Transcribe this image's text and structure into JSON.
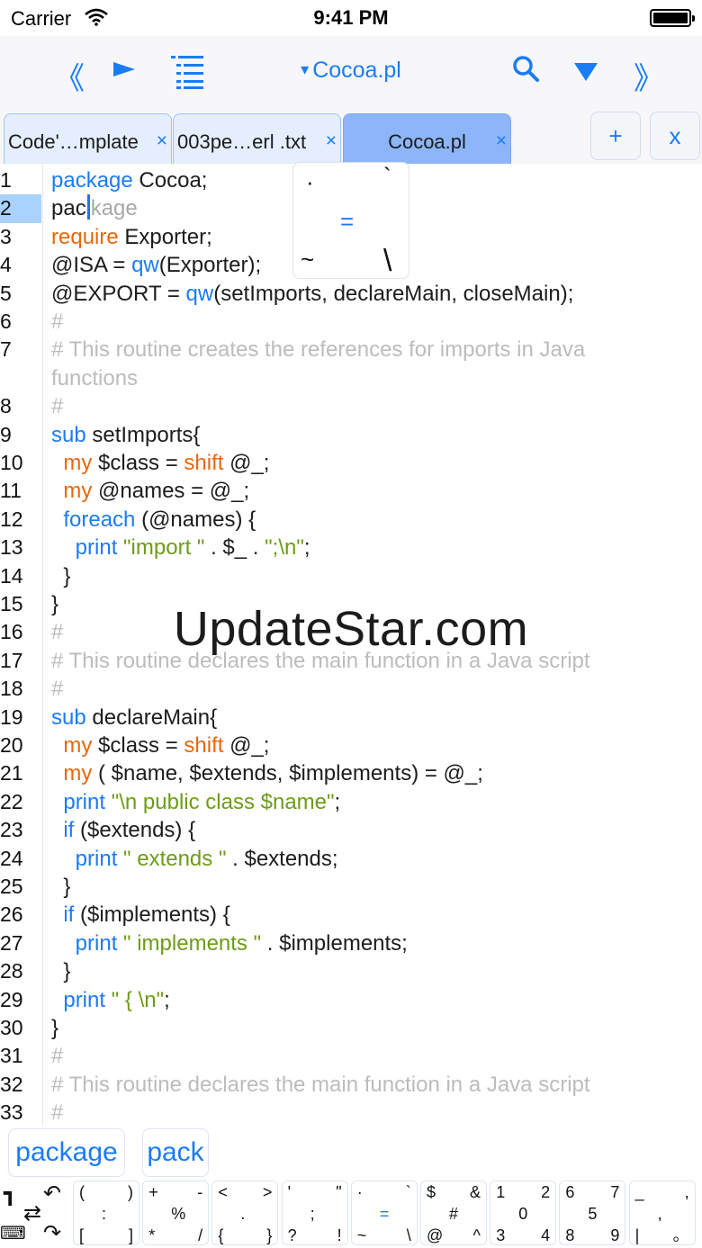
{
  "status": {
    "carrier": "Carrier",
    "time": "9:41 PM"
  },
  "toolbar": {
    "prev_label": "《",
    "next_label": "》",
    "file_caret": "▾",
    "file_name": "Cocoa.pl",
    "icons": [
      "double-chevron-left-icon",
      "play-icon",
      "outline-list-icon",
      "search-icon",
      "triangle-down-icon",
      "double-chevron-right-icon"
    ]
  },
  "tabs": [
    {
      "label": "Code'…mplate",
      "close": "×"
    },
    {
      "label": "003pe…erl .txt",
      "close": "×"
    },
    {
      "label": "Cocoa.pl",
      "close": "×"
    }
  ],
  "tab_actions": {
    "add": "+",
    "close": "x"
  },
  "editor": {
    "line_numbers": [
      "1",
      "2",
      "3",
      "4",
      "5",
      "6",
      "7",
      "",
      "8",
      "9",
      "10",
      "11",
      "12",
      "13",
      "14",
      "15",
      "16",
      "17",
      "18",
      "19",
      "20",
      "21",
      "22",
      "23",
      "24",
      "25",
      "26",
      "27",
      "28",
      "29",
      "30",
      "31",
      "32",
      "33"
    ],
    "lines": [
      [
        {
          "t": "package",
          "c": "k"
        },
        {
          "t": " Cocoa;",
          "c": ""
        }
      ],
      [
        {
          "t": "pac",
          "c": ""
        },
        {
          "t": "kage",
          "c": "ghost"
        }
      ],
      [
        {
          "t": "require",
          "c": "o"
        },
        {
          "t": " Exporter;",
          "c": ""
        }
      ],
      [
        {
          "t": "@ISA = ",
          "c": ""
        },
        {
          "t": "qw",
          "c": "k"
        },
        {
          "t": "(Exporter);",
          "c": ""
        }
      ],
      [
        {
          "t": "@EXPORT = ",
          "c": ""
        },
        {
          "t": "qw",
          "c": "k"
        },
        {
          "t": "(setImports, declareMain, closeMain);",
          "c": ""
        }
      ],
      [
        {
          "t": "#",
          "c": "c"
        }
      ],
      [
        {
          "t": "# This routine creates the references for imports in Java",
          "c": "c"
        }
      ],
      [
        {
          "t": "functions",
          "c": "c"
        }
      ],
      [
        {
          "t": "#",
          "c": "c"
        }
      ],
      [
        {
          "t": "sub",
          "c": "k"
        },
        {
          "t": " setImports{",
          "c": ""
        }
      ],
      [
        {
          "t": "  ",
          "c": ""
        },
        {
          "t": "my",
          "c": "o"
        },
        {
          "t": " $class = ",
          "c": ""
        },
        {
          "t": "shift",
          "c": "o"
        },
        {
          "t": " @_;",
          "c": ""
        }
      ],
      [
        {
          "t": "  ",
          "c": ""
        },
        {
          "t": "my",
          "c": "o"
        },
        {
          "t": " @names = @_;",
          "c": ""
        }
      ],
      [
        {
          "t": "  ",
          "c": ""
        },
        {
          "t": "foreach",
          "c": "k"
        },
        {
          "t": " (@names) {",
          "c": ""
        }
      ],
      [
        {
          "t": "    ",
          "c": ""
        },
        {
          "t": "print",
          "c": "k"
        },
        {
          "t": " ",
          "c": ""
        },
        {
          "t": "\"import \"",
          "c": "s"
        },
        {
          "t": " . $_ . ",
          "c": ""
        },
        {
          "t": "\";\\n\"",
          "c": "s"
        },
        {
          "t": ";",
          "c": ""
        }
      ],
      [
        {
          "t": "  }",
          "c": ""
        }
      ],
      [
        {
          "t": "}",
          "c": ""
        }
      ],
      [
        {
          "t": "#",
          "c": "c"
        }
      ],
      [
        {
          "t": "# This routine declares the main function in a Java script",
          "c": "c"
        }
      ],
      [
        {
          "t": "#",
          "c": "c"
        }
      ],
      [
        {
          "t": "sub",
          "c": "k"
        },
        {
          "t": " declareMain{",
          "c": ""
        }
      ],
      [
        {
          "t": "  ",
          "c": ""
        },
        {
          "t": "my",
          "c": "o"
        },
        {
          "t": " $class = ",
          "c": ""
        },
        {
          "t": "shift",
          "c": "o"
        },
        {
          "t": " @_;",
          "c": ""
        }
      ],
      [
        {
          "t": "  ",
          "c": ""
        },
        {
          "t": "my",
          "c": "o"
        },
        {
          "t": " ( $name, $extends, $implements) = @_;",
          "c": ""
        }
      ],
      [
        {
          "t": "  ",
          "c": ""
        },
        {
          "t": "print",
          "c": "k"
        },
        {
          "t": " ",
          "c": ""
        },
        {
          "t": "\"\\n public class $name\"",
          "c": "s"
        },
        {
          "t": ";",
          "c": ""
        }
      ],
      [
        {
          "t": "  ",
          "c": ""
        },
        {
          "t": "if",
          "c": "k"
        },
        {
          "t": " ($extends) {",
          "c": ""
        }
      ],
      [
        {
          "t": "    ",
          "c": ""
        },
        {
          "t": "print",
          "c": "k"
        },
        {
          "t": " ",
          "c": ""
        },
        {
          "t": "\" extends \"",
          "c": "s"
        },
        {
          "t": " . $extends;",
          "c": ""
        }
      ],
      [
        {
          "t": "  }",
          "c": ""
        }
      ],
      [
        {
          "t": "  ",
          "c": ""
        },
        {
          "t": "if",
          "c": "k"
        },
        {
          "t": " ($implements) {",
          "c": ""
        }
      ],
      [
        {
          "t": "    ",
          "c": ""
        },
        {
          "t": "print",
          "c": "k"
        },
        {
          "t": " ",
          "c": ""
        },
        {
          "t": "\" implements \"",
          "c": "s"
        },
        {
          "t": " . $implements;",
          "c": ""
        }
      ],
      [
        {
          "t": "  }",
          "c": ""
        }
      ],
      [
        {
          "t": "  ",
          "c": ""
        },
        {
          "t": "print",
          "c": "k"
        },
        {
          "t": " ",
          "c": ""
        },
        {
          "t": "\" { \\n\"",
          "c": "s"
        },
        {
          "t": ";",
          "c": ""
        }
      ],
      [
        {
          "t": "}",
          "c": ""
        }
      ],
      [
        {
          "t": "#",
          "c": "c"
        }
      ],
      [
        {
          "t": "# This routine declares the main function in a Java script",
          "c": "c"
        }
      ],
      [
        {
          "t": "#",
          "c": "c"
        }
      ]
    ],
    "current_line": "2"
  },
  "popup_keys": {
    "dot": "·",
    "backtick": "`",
    "equals": "=",
    "tilde": "~",
    "backslash": "\\"
  },
  "watermark": "UpdateStar.com",
  "suggestions": [
    "package",
    "pack"
  ],
  "keyboard": {
    "special": [
      "┓",
      "↶",
      "⇄",
      "⌨",
      "↷"
    ],
    "keys": [
      [
        "(",
        ")",
        ":",
        "[",
        "]"
      ],
      [
        "+",
        "-",
        "%",
        "*",
        "/"
      ],
      [
        "<",
        ">",
        ".",
        "{",
        "}"
      ],
      [
        "'",
        "\"",
        ";",
        "?",
        "!"
      ],
      [
        "·",
        "`",
        "=",
        "~",
        "\\"
      ],
      [
        "$",
        "&",
        "#",
        "@",
        "^"
      ],
      [
        "1",
        "2",
        "0",
        "3",
        "4"
      ],
      [
        "6",
        "7",
        "5",
        "8",
        "9"
      ],
      [
        "_",
        ",",
        ",",
        "|",
        "。"
      ]
    ]
  },
  "colors": {
    "accent": "#1a7cf5",
    "keyword_orange": "#e8670c",
    "string_green": "#6d9c17",
    "comment_gray": "#bcbcbc",
    "active_tab": "#8cb6f9",
    "current_line": "#a9d2ff"
  }
}
